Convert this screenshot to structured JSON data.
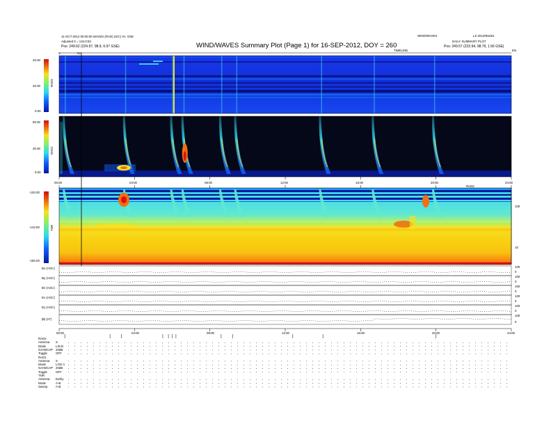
{
  "header": {
    "title": "WIND/WAVES Summary Plot (Page 1) for 16-SEP-2012, DOY = 260",
    "left_line1": "11-OCT-2012 00:00:00 WAVES (RAD) (S/C) Vs. GSE",
    "left_line2": "Adjusted 0 = 134.0:53",
    "left_line3": "Pos: 249.62 (224.97, 98.9, 6.97 GSE)",
    "right_line1": "WIND/WAVES",
    "right_line2": "DAILY SUMMARY PLOT",
    "right_line3": "Pos: 249.57 (223.94, 98.79, 1.56 GSE)",
    "right_top": "LZ 2012091601",
    "timeline_label": "TIMELINE",
    "cal_label": "Cal",
    "v_label": "V",
    "end_label": "EN",
    "rad_tick": "RAD2",
    "bottom_tick_label": "RAD1"
  },
  "panels": {
    "rad2": {
      "ylabel": "RAD2",
      "ticks": [
        "40.00",
        "20.00",
        "0.00"
      ]
    },
    "rad1": {
      "ylabel": "RAD1",
      "ticks": [
        "50.00",
        "30.00",
        "0.00"
      ]
    },
    "tnr": {
      "ylabel": "TNR",
      "ticks": [
        "-130.00",
        "-142.50",
        "-155.00"
      ],
      "right_ticks": [
        "100",
        "10"
      ]
    }
  },
  "hour_ticks": [
    "00:00",
    "04:00",
    "08:00",
    "12:00",
    "16:00",
    "20:00",
    "24:00"
  ],
  "bottom_hour_ticks": [
    "00:00",
    "04:00",
    "08:00",
    "12:00",
    "16:00",
    "20:00",
    "24:00"
  ],
  "line_panels": [
    {
      "label": "Bx (AGC)",
      "r1": "100",
      "r2": "0"
    },
    {
      "label": "By (AGC)",
      "r1": "100",
      "r2": "0"
    },
    {
      "label": "Bz (AGC)",
      "r1": "100",
      "r2": "0"
    },
    {
      "label": "Ex (AGC)",
      "r1": "100",
      "r2": "0"
    },
    {
      "label": "Ey (AGC)",
      "r1": "100",
      "r2": "0"
    },
    {
      "label": "|B| (nT)",
      "r1": "100",
      "r2": "0"
    }
  ],
  "status_rows": [
    {
      "label": "RAD2",
      "value": ""
    },
    {
      "label": "Antenna",
      "value": "S"
    },
    {
      "label": "Mode",
      "value": "LIN B"
    },
    {
      "label": "GAIN/CAP",
      "value": "20dB"
    },
    {
      "label": "Toggle",
      "value": "OFF"
    },
    {
      "label": "RAD1",
      "value": ""
    },
    {
      "label": "Antenna",
      "value": "S"
    },
    {
      "label": "Mode",
      "value": "LOG A"
    },
    {
      "label": "GAIN/CAP",
      "value": "20dB"
    },
    {
      "label": "Toggle",
      "value": "OFF"
    },
    {
      "label": "TNR",
      "value": ""
    },
    {
      "label": "Antenna",
      "value": "Ex/Ey"
    },
    {
      "label": "Mode",
      "value": "A-B"
    },
    {
      "label": "Sweep",
      "value": "A-B"
    }
  ],
  "colors": {
    "background_blue": "#1030d8",
    "rad1_background": "#050818",
    "tnr_cyan": "#30d8f0",
    "tnr_yellow": "#f8e020",
    "tnr_red": "#e01010"
  },
  "chart_data": {
    "type": "heatmap",
    "title": "WIND/WAVES Summary Plot (Page 1) for 16-SEP-2012, DOY = 260",
    "x": [
      "00:00",
      "04:00",
      "08:00",
      "12:00",
      "16:00",
      "20:00",
      "24:00"
    ],
    "xlim": [
      0,
      24
    ],
    "panels": [
      {
        "name": "RAD2",
        "ylim": [
          0,
          40
        ],
        "colorbar": [
          0,
          40
        ]
      },
      {
        "name": "RAD1",
        "ylim": [
          0,
          50
        ],
        "colorbar": [
          0,
          50
        ]
      },
      {
        "name": "TNR",
        "ylim": [
          -155,
          -130
        ],
        "colorbar": [
          -155,
          -130
        ]
      }
    ],
    "bursts_hours": [
      0.3,
      3.5,
      6.0,
      6.6,
      8.6,
      9.4,
      13.9,
      16.7,
      19.9
    ],
    "grid": false,
    "legend": "none"
  }
}
